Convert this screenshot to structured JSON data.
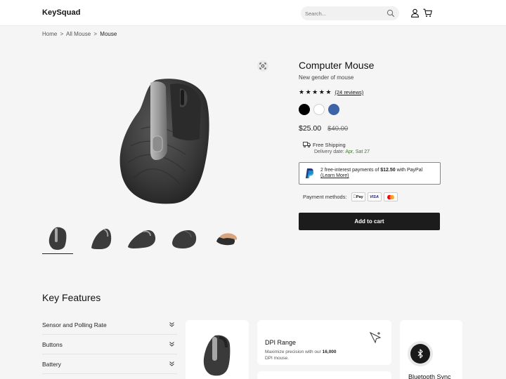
{
  "header": {
    "logo": "KeySquad",
    "search_placeholder": "Search..."
  },
  "breadcrumb": {
    "items": [
      "Home",
      "All Mouse"
    ],
    "current": "Mouse",
    "separator": ">"
  },
  "product": {
    "title": "Computer Mouse",
    "subtitle": "New gender of mouse",
    "rating_stars": 5,
    "reviews": "(24 reviews)",
    "colors": [
      "#000000",
      "#ffffff",
      "#3d63a8"
    ],
    "price": "$25.00",
    "old_price": "$40.00",
    "shipping_label": "Free Shipping",
    "delivery_prefix": "Delivery date:",
    "delivery_date": "Apr, Sat 27",
    "paypal_text_before": "2 free-interest payments of",
    "paypal_amount": "$12.50",
    "paypal_text_after": "with PayPal",
    "paypal_learn_more": "(Learn More)",
    "payment_methods_label": "Payment methods:",
    "payment_methods": [
      "applepay-icon",
      "visa-icon",
      "mastercard-icon"
    ],
    "applepay_text": "Pay",
    "visa_text": "VISA",
    "add_to_cart": "Add to cart"
  },
  "key_features": {
    "title": "Key Features",
    "accordion": [
      {
        "label": "Sensor and Polling Rate"
      },
      {
        "label": "Buttons"
      },
      {
        "label": "Battery"
      }
    ],
    "dpi_card": {
      "title": "DPI Range",
      "desc_before": "Maximize precision with our",
      "desc_num": "16,000",
      "desc_after": "DPI mouse."
    },
    "bluetooth_card": {
      "title": "Bluetooth Sync"
    }
  },
  "colors": {
    "accent": "#1c1c1c",
    "delivery_date": "#3a7a2a",
    "paypal_blue": "#253b80"
  }
}
